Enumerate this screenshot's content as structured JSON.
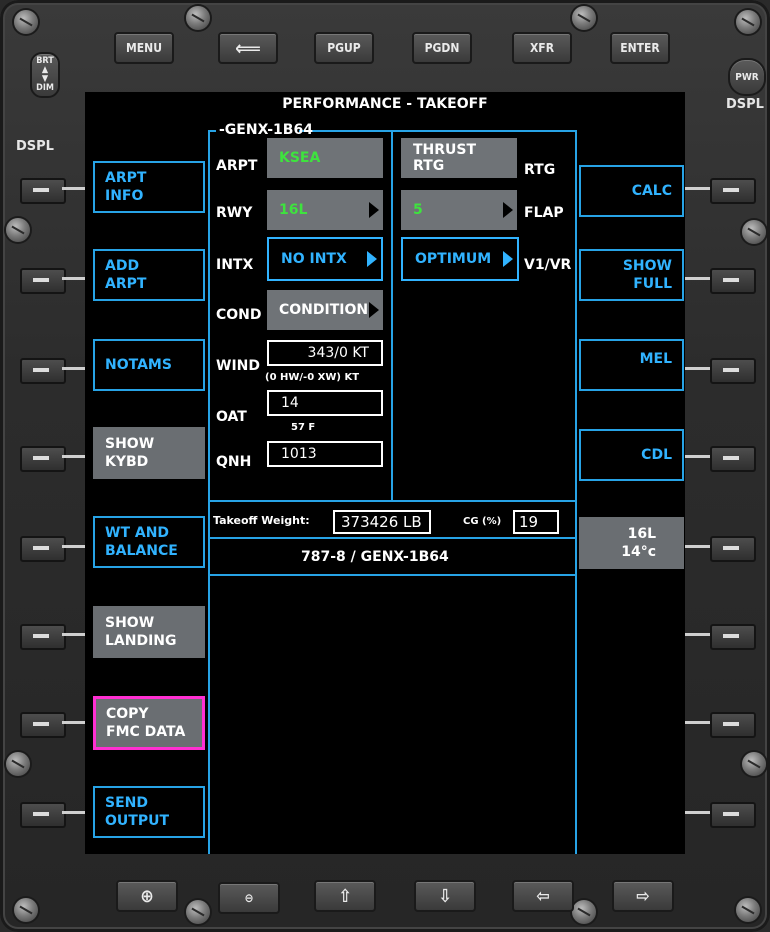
{
  "hardware": {
    "top_buttons": [
      "MENU",
      "",
      "PGUP",
      "PGDN",
      "XFR",
      "ENTER"
    ],
    "brt": "BRT",
    "dim": "DIM",
    "dspl_left": "DSPL",
    "pwr": "PWR",
    "dspl_right": "DSPL"
  },
  "screen": {
    "title": "PERFORMANCE - TAKEOFF",
    "engine_header": "-GENX-1B64",
    "left_keys": [
      {
        "line1": "ARPT",
        "line2": "INFO"
      },
      {
        "line1": "ADD",
        "line2": "ARPT"
      },
      {
        "line1": "NOTAMS",
        "line2": ""
      },
      {
        "line1": "SHOW",
        "line2": "KYBD"
      },
      {
        "line1": "WT AND",
        "line2": "BALANCE"
      },
      {
        "line1": "SHOW",
        "line2": "LANDING"
      },
      {
        "line1": "COPY",
        "line2": "FMC DATA"
      },
      {
        "line1": "SEND",
        "line2": "OUTPUT"
      }
    ],
    "right_keys": [
      {
        "line1": "CALC",
        "line2": ""
      },
      {
        "line1": "SHOW",
        "line2": "FULL"
      },
      {
        "line1": "MEL",
        "line2": ""
      },
      {
        "line1": "CDL",
        "line2": ""
      },
      {
        "line1": "16L",
        "line2": "14°c"
      }
    ],
    "fields": {
      "arpt_label": "ARPT",
      "arpt_value": "KSEA",
      "rwy_label": "RWY",
      "rwy_value": "16L",
      "intx_label": "INTX",
      "intx_value": "NO INTX",
      "cond_label": "COND",
      "cond_value": "CONDITION",
      "wind_label": "WIND",
      "wind_value": "343/0 KT",
      "wind_sub": "(0 HW/-0 XW) KT",
      "oat_label": "OAT",
      "oat_value": "14",
      "oat_sub": "57 F",
      "qnh_label": "QNH",
      "qnh_value": "1013",
      "thrust_value": "THRUST RTG",
      "thrust_label": "RTG",
      "flap_value": "5",
      "flap_label": "FLAP",
      "v_value": "OPTIMUM",
      "v_label": "V1/VR"
    },
    "weight": {
      "label": "Takeoff Weight:",
      "value": "373426 LB",
      "cg_label": "CG (%)",
      "cg_value": "19"
    },
    "model": "787-8 / GENX-1B64"
  },
  "colors": {
    "accent": "#31b3ff",
    "green": "#3ee33e",
    "highlight": "#ff2fd2",
    "gray_button": "#6f7377"
  }
}
